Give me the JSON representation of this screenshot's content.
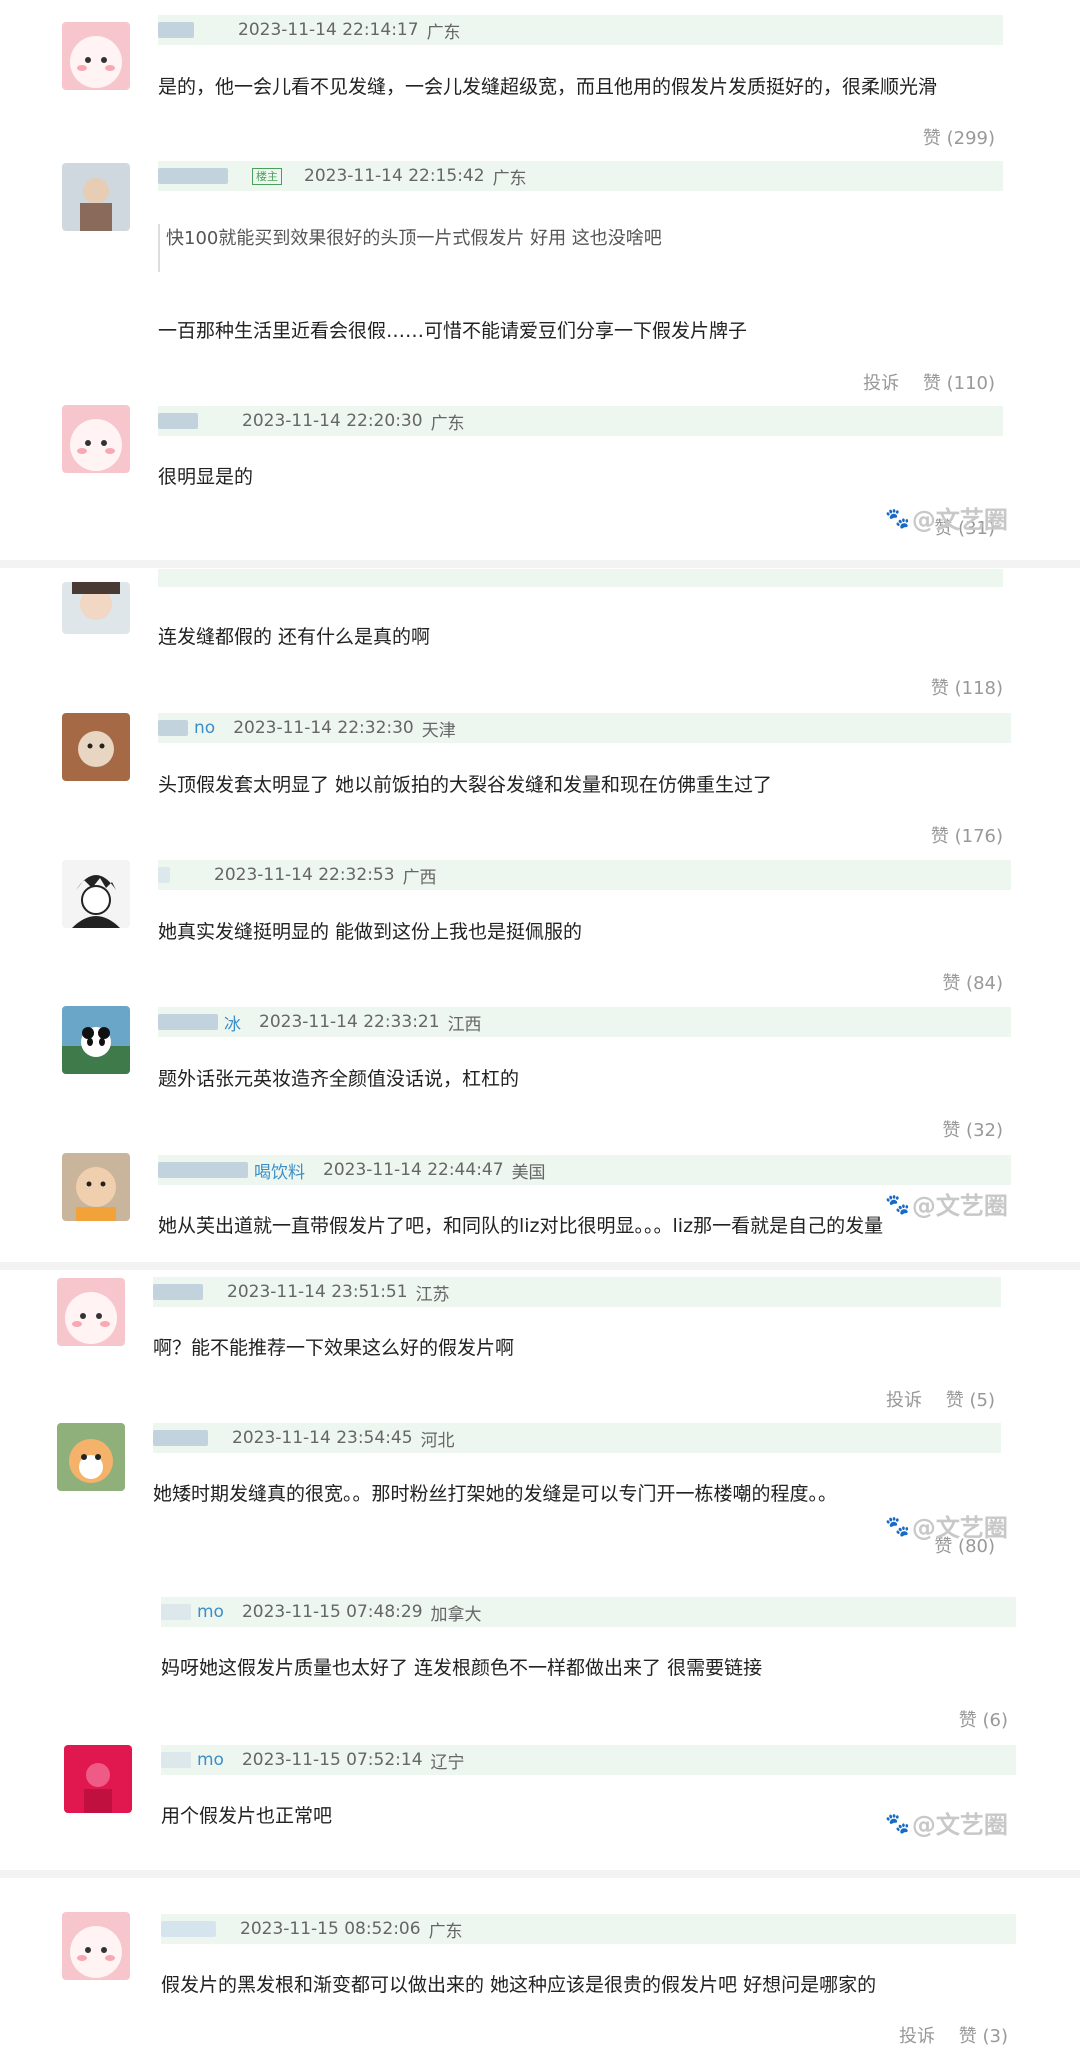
{
  "comments": [
    {
      "user": "",
      "time": "2023-11-14 22:14:17",
      "region": "广东",
      "text": "是的，他一会儿看不见发缝，一会儿发缝超级宽，而且他用的假发片发质挺好的，很柔顺光滑",
      "like": "赞 (299)"
    },
    {
      "user": "",
      "badge": "楼主",
      "time": "2023-11-14 22:15:42",
      "region": "广东",
      "quote": "快100就能买到效果很好的头顶一片式假发片 好用 这也没啥吧",
      "text": "一百那种生活里近看会很假……可惜不能请爱豆们分享一下假发片牌子",
      "report": "投诉",
      "like": "赞 (110)"
    },
    {
      "user": "",
      "time": "2023-11-14 22:20:30",
      "region": "广东",
      "text": "很明显是的",
      "like": "赞 (31)"
    },
    {
      "user": "",
      "time": "",
      "region": "",
      "text": "连发缝都假的 还有什么是真的啊",
      "like": "赞 (118)"
    },
    {
      "user": "no",
      "time": "2023-11-14 22:32:30",
      "region": "天津",
      "text": "头顶假发套太明显了 她以前饭拍的大裂谷发缝和发量和现在仿佛重生过了",
      "like": "赞 (176)"
    },
    {
      "user": "",
      "time": "2023-11-14 22:32:53",
      "region": "广西",
      "text": "她真实发缝挺明显的 能做到这份上我也是挺佩服的",
      "like": "赞 (84)"
    },
    {
      "user": "冰",
      "time": "2023-11-14 22:33:21",
      "region": "江西",
      "text": "题外话张元英妆造齐全颜值没话说，杠杠的",
      "like": "赞 (32)"
    },
    {
      "user": "喝饮料",
      "time": "2023-11-14 22:44:47",
      "region": "美国",
      "text": "她从芙出道就一直带假发片了吧，和同队的liz对比很明显。。。liz那一看就是自己的发量",
      "like": ""
    },
    {
      "user": "",
      "time": "2023-11-14 23:51:51",
      "region": "江苏",
      "text": "啊？能不能推荐一下效果这么好的假发片啊",
      "report": "投诉",
      "like": "赞 (5)"
    },
    {
      "user": "",
      "time": "2023-11-14 23:54:45",
      "region": "河北",
      "text": "她矮时期发缝真的很宽。。那时粉丝打架她的发缝是可以专门开一栋楼嘲的程度。。",
      "like": "赞 (80)"
    },
    {
      "user": "mo",
      "time": "2023-11-15 07:48:29",
      "region": "加拿大",
      "text": "妈呀她这假发片质量也太好了 连发根颜色不一样都做出来了 很需要链接",
      "like": "赞 (6)"
    },
    {
      "user": "mo",
      "time": "2023-11-15 07:52:14",
      "region": "辽宁",
      "text": "用个假发片也正常吧",
      "like": ""
    },
    {
      "user": "",
      "time": "2023-11-15 08:52:06",
      "region": "广东",
      "text": "假发片的黑发根和渐变都可以做出来的 她这种应该是很贵的假发片吧 好想问是哪家的",
      "report": "投诉",
      "like": "赞 (3)"
    }
  ],
  "watermark": {
    "text": "@文艺圈"
  },
  "colors": {
    "meta_bg": "#eef6f0",
    "username": "#3a8fc8",
    "like": "#999999"
  }
}
